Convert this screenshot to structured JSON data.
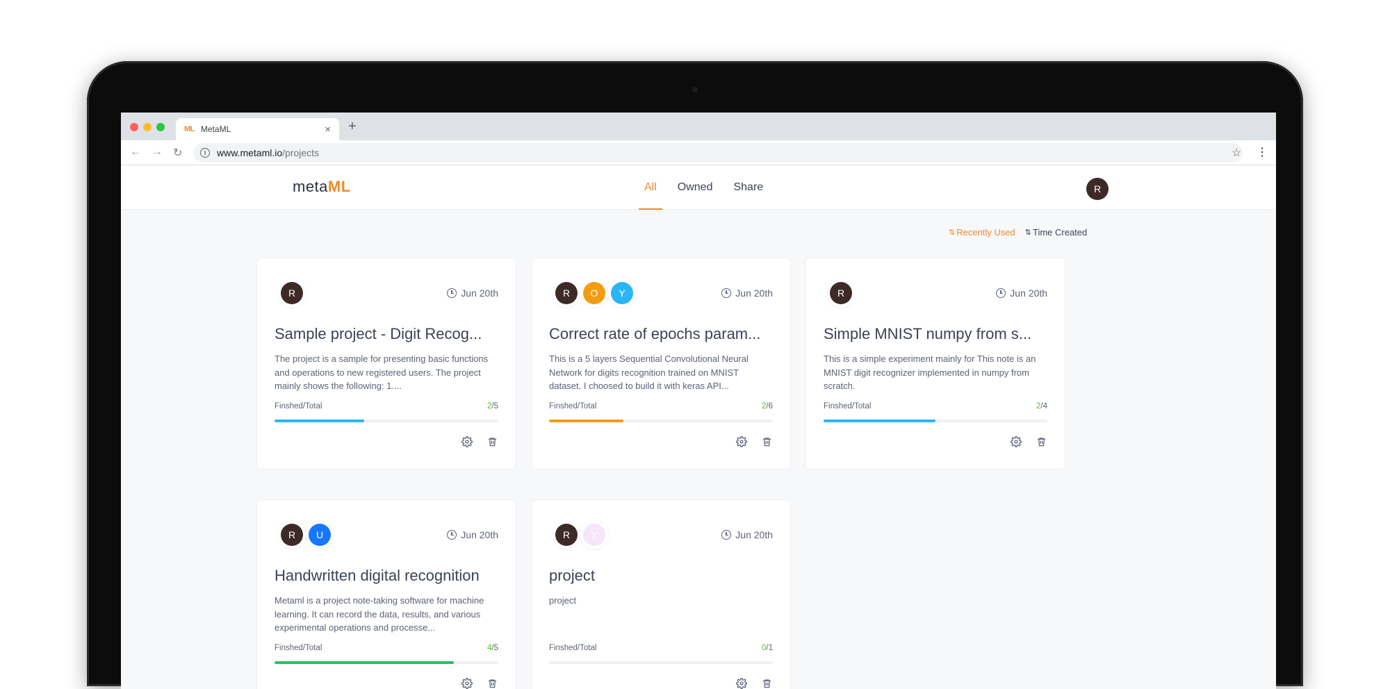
{
  "browser": {
    "tab_title": "MetaML",
    "tab_favicon": "ML",
    "close_glyph": "×",
    "newtab_glyph": "+",
    "url_host": "www.metaml.io",
    "url_path": "/projects"
  },
  "header": {
    "logo_meta": "meta",
    "logo_ml": "ML",
    "tabs": [
      "All",
      "Owned",
      "Share"
    ],
    "active_tab": "All",
    "user_initial": "R"
  },
  "sort": {
    "recently_used": "Recently Used",
    "time_created": "Time Created",
    "active": "Recently Used"
  },
  "colors": {
    "accent": "#f08a24",
    "avatar_R": "#3d2a26",
    "avatar_O": "#f39c12",
    "avatar_Y": "#29b6f6",
    "avatar_U": "#1677ff",
    "avatar_Y_faded": "#f5e6fa",
    "done_text": "#52c41a"
  },
  "projects": [
    {
      "members": [
        {
          "initial": "R",
          "color": "#3d2a26"
        }
      ],
      "date": "Jun 20th",
      "title": "Sample project - Digit Recog...",
      "description": "The project is a sample for presenting basic functions and operations to new registered users. The project mainly shows the following: 1....",
      "progress_label": "Finshed/Total",
      "finished": "2",
      "total": "/5",
      "progress_fraction": 0.4,
      "bar_color": "#29b6f6"
    },
    {
      "members": [
        {
          "initial": "R",
          "color": "#3d2a26"
        },
        {
          "initial": "O",
          "color": "#f39c12"
        },
        {
          "initial": "Y",
          "color": "#29b6f6"
        }
      ],
      "date": "Jun 20th",
      "title": "Correct rate of epochs param...",
      "description": "This is a 5 layers Sequential Convolutional Neural Network for digits recognition trained on MNIST dataset. I choosed to build it with keras API...",
      "progress_label": "Finshed/Total",
      "finished": "2",
      "total": "/6",
      "progress_fraction": 0.333,
      "bar_color": "#f39c12"
    },
    {
      "members": [
        {
          "initial": "R",
          "color": "#3d2a26"
        }
      ],
      "date": "Jun 20th",
      "title": "Simple MNIST numpy from s...",
      "description": "This is a simple experiment mainly for This note is an MNIST digit recognizer implemented in numpy from scratch.",
      "progress_label": "Finshed/Total",
      "finished": "2",
      "total": "/4",
      "progress_fraction": 0.5,
      "bar_color": "#29b6f6"
    },
    {
      "members": [
        {
          "initial": "R",
          "color": "#3d2a26"
        },
        {
          "initial": "U",
          "color": "#1677ff"
        }
      ],
      "date": "Jun 20th",
      "title": "Handwritten digital recognition",
      "description": "Metaml is a project note-taking software for machine learning. It can record the data, results, and various experimental operations and processe...",
      "progress_label": "Finshed/Total",
      "finished": "4",
      "total": "/5",
      "progress_fraction": 0.8,
      "bar_color": "#23c45e"
    },
    {
      "members": [
        {
          "initial": "R",
          "color": "#3d2a26"
        },
        {
          "initial": "Y",
          "color": "#f5e6fa"
        }
      ],
      "date": "Jun 20th",
      "title": "project",
      "description": "project",
      "progress_label": "Finshed/Total",
      "finished": "0",
      "total": "/1",
      "progress_fraction": 0,
      "bar_color": "#29b6f6"
    }
  ]
}
